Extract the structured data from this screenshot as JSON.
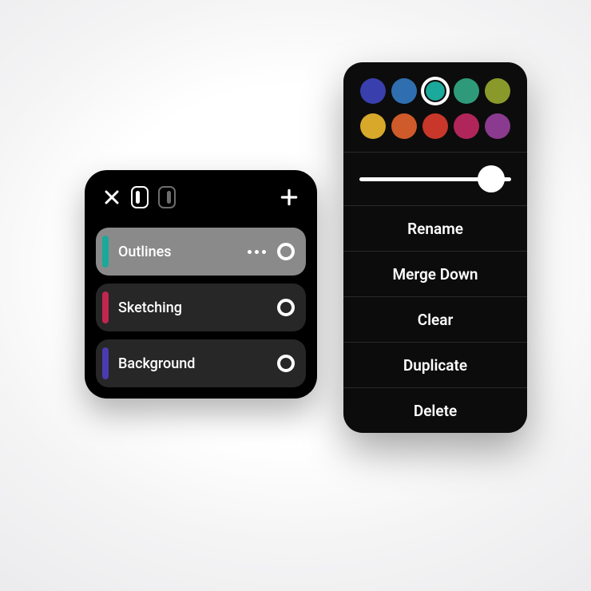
{
  "layers_panel": {
    "layers": [
      {
        "name": "Outlines",
        "color": "#1aa99a",
        "selected": true
      },
      {
        "name": "Sketching",
        "color": "#c1264f",
        "selected": false
      },
      {
        "name": "Background",
        "color": "#4a3bb0",
        "selected": false
      }
    ]
  },
  "options": {
    "swatches": [
      {
        "color": "#3a3fae",
        "selected": false
      },
      {
        "color": "#2f6fb0",
        "selected": false
      },
      {
        "color": "#1aa99a",
        "selected": true
      },
      {
        "color": "#2f9a7a",
        "selected": false
      },
      {
        "color": "#8a9a2a",
        "selected": false
      },
      {
        "color": "#d7a82a",
        "selected": false
      },
      {
        "color": "#cf5a2a",
        "selected": false
      },
      {
        "color": "#c9372a",
        "selected": false
      },
      {
        "color": "#b0265a",
        "selected": false
      },
      {
        "color": "#8a3a8f",
        "selected": false
      }
    ],
    "opacity": 0.87,
    "actions": {
      "rename": "Rename",
      "merge_down": "Merge Down",
      "clear": "Clear",
      "duplicate": "Duplicate",
      "delete": "Delete"
    }
  }
}
